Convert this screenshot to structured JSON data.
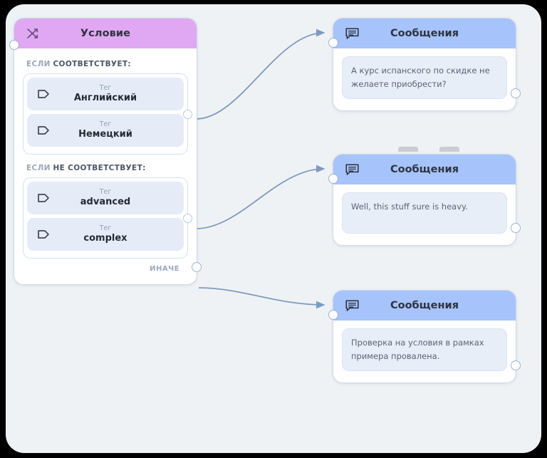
{
  "canvas": {
    "background_color": "#eff2f5",
    "frame_outside_color": "#000000"
  },
  "condition_node": {
    "title": "Условие",
    "icon": "shuffle-branch-icon",
    "header_color": "#e0a8f2",
    "input_port": "condition-input-port",
    "branches": [
      {
        "id": "match",
        "prefix": "ЕСЛИ",
        "label": "СООТВЕТСТВУЕТ:",
        "tags": [
          {
            "kind": "Тег",
            "value": "Английский",
            "icon": "tag-icon"
          },
          {
            "kind": "Тег",
            "value": "Немецкий",
            "icon": "tag-icon"
          }
        ]
      },
      {
        "id": "nomatch",
        "prefix": "ЕСЛИ",
        "label": "НЕ СООТВЕТСТВУЕТ:",
        "tags": [
          {
            "kind": "Тег",
            "value": "advanced",
            "icon": "tag-icon"
          },
          {
            "kind": "Тег",
            "value": "complex",
            "icon": "tag-icon"
          }
        ]
      }
    ],
    "else_label": "ИНАЧЕ"
  },
  "message_nodes": [
    {
      "id": "msg-1",
      "title": "Сообщения",
      "icon": "message-icon",
      "header_color": "#a6c3fb",
      "text": "А курс испанского по скидке не желаете приобрести?"
    },
    {
      "id": "msg-2",
      "title": "Сообщения",
      "icon": "message-icon",
      "header_color": "#a6c3fb",
      "text": "Well, this stuff sure is heavy."
    },
    {
      "id": "msg-3",
      "title": "Сообщения",
      "icon": "message-icon",
      "header_color": "#a6c3fb",
      "text": "Проверка на условия в рамках примера провалена."
    }
  ],
  "edges": [
    {
      "id": "edge-match",
      "from": "condition-output-match",
      "to": "msg-1-input"
    },
    {
      "id": "edge-nomatch",
      "from": "condition-output-nomatch",
      "to": "msg-2-input"
    },
    {
      "id": "edge-else",
      "from": "condition-output-else",
      "to": "msg-3-input"
    }
  ]
}
